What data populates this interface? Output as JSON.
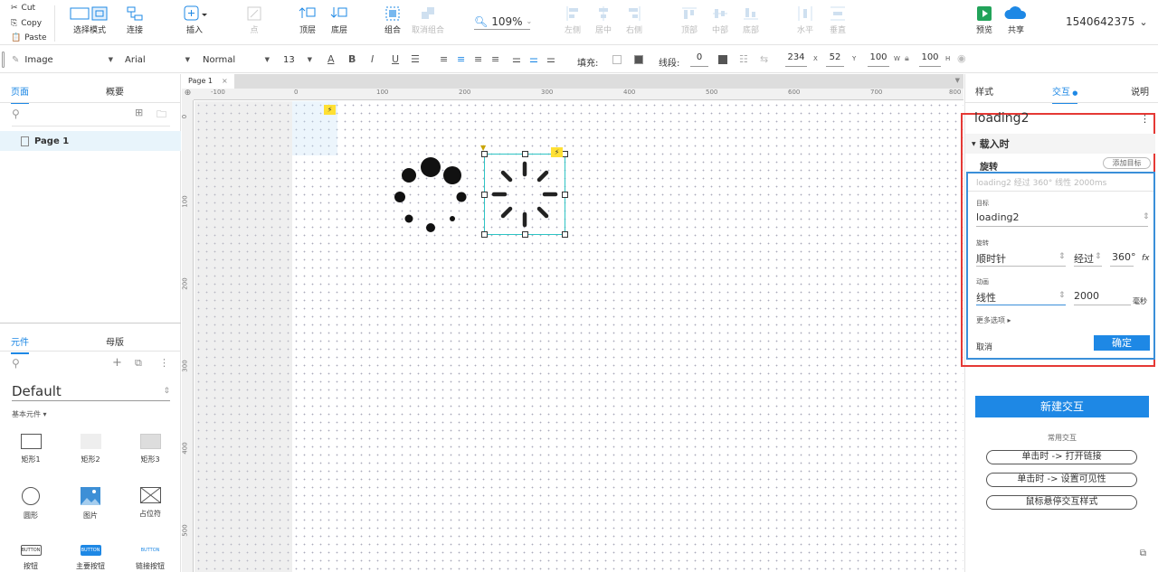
{
  "clipboard": {
    "cut": "Cut",
    "copy": "Copy",
    "paste": "Paste"
  },
  "toolbar": {
    "select_mode": "选择模式",
    "connect": "连接",
    "insert": "插入",
    "point": "点",
    "top_layer": "顶层",
    "bottom_layer": "底层",
    "group": "组合",
    "ungroup": "取消组合",
    "zoom": "109%",
    "align_left": "左侧",
    "align_center": "居中",
    "align_right": "右侧",
    "align_top": "顶部",
    "align_middle": "中部",
    "align_bottom": "底部",
    "dist_h": "水平",
    "dist_v": "垂直",
    "preview": "预览",
    "share": "共享",
    "user_id": "1540642375"
  },
  "format": {
    "widget_type": "Image",
    "font": "Arial",
    "style": "Normal",
    "size": "13",
    "fill_label": "填充:",
    "line_label": "线段:",
    "line_value": "0",
    "x": "234",
    "x_label": "X",
    "y": "52",
    "y_label": "Y",
    "w": "100",
    "w_label": "W",
    "h": "100",
    "h_label": "H"
  },
  "left": {
    "tab_pages": "页面",
    "tab_outline": "概要",
    "page1": "Page 1",
    "tab_widgets": "元件",
    "tab_masters": "母版",
    "library": "Default",
    "category": "基本元件 ▾",
    "widgets": [
      "矩形1",
      "矩形2",
      "矩形3",
      "圆形",
      "图片",
      "占位符",
      "按钮",
      "主要按钮",
      "链接按钮"
    ],
    "button_text": "BUTTON"
  },
  "canvas": {
    "tab": "Page 1",
    "hticks": [
      "-100",
      "0",
      "100",
      "200",
      "300",
      "400",
      "500",
      "600",
      "700",
      "800"
    ],
    "vticks": [
      "0",
      "100",
      "200",
      "300",
      "400",
      "500"
    ]
  },
  "right": {
    "tab_style": "样式",
    "tab_interaction": "交互",
    "tab_notes": "说明",
    "widget_name": "loading2",
    "event": "载入时",
    "action": "旋转",
    "add_target": "添加目标",
    "summary": "loading2 经过 360° 线性 2000ms",
    "target_label": "目标",
    "target_value": "loading2",
    "rotate_label": "旋转",
    "direction": "顺时针",
    "by": "经过",
    "degrees": "360°",
    "anim_label": "动画",
    "easing": "线性",
    "duration": "2000",
    "unit": "毫秒",
    "more": "更多选项 ▸",
    "cancel": "取消",
    "confirm": "确定",
    "new_interaction": "新建交互",
    "common": "常用交互",
    "common_items": [
      "单击时 -> 打开链接",
      "单击时 -> 设置可见性",
      "鼠标悬停交互样式"
    ]
  },
  "colors": {
    "accent": "#1e88e5",
    "highlight": "#e53935",
    "selection": "#2ec4c4"
  }
}
